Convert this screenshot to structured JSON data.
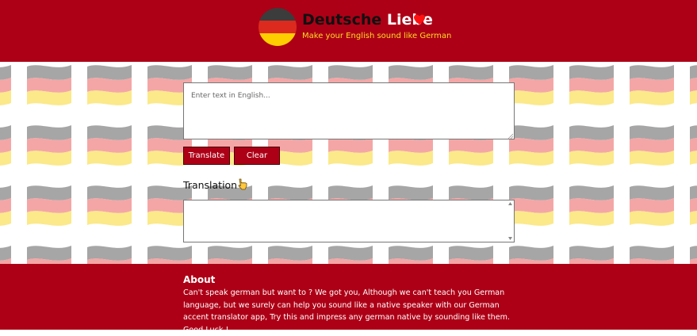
{
  "header": {
    "brand_part1": "Deutsche",
    "brand_part2": "Liebe",
    "tagline": "Make your English sound like German"
  },
  "colors": {
    "primary_red": "#ad0016",
    "flag_black": "#3c3c3c",
    "flag_red": "#dc2a1e",
    "flag_gold": "#ffce00",
    "tagline_yellow": "#ffdd22"
  },
  "icons": {
    "logo": "german-flag-circle-icon",
    "heart": "heart-icon",
    "pointer": "pointing-down-hand-icon",
    "background": "waving-german-flag-pattern"
  },
  "translator": {
    "input_placeholder": "Enter text in English...",
    "translate_label": "Translate",
    "clear_label": "Clear",
    "translation_heading": "Translation"
  },
  "about": {
    "title": "About",
    "text": "Can't speak german but want to ? We got you, Although we can't teach you German language, but we surely can help you sound like a native speaker with our German accent translator app, Try this and impress any german native by sounding like them. Good Luck !"
  }
}
